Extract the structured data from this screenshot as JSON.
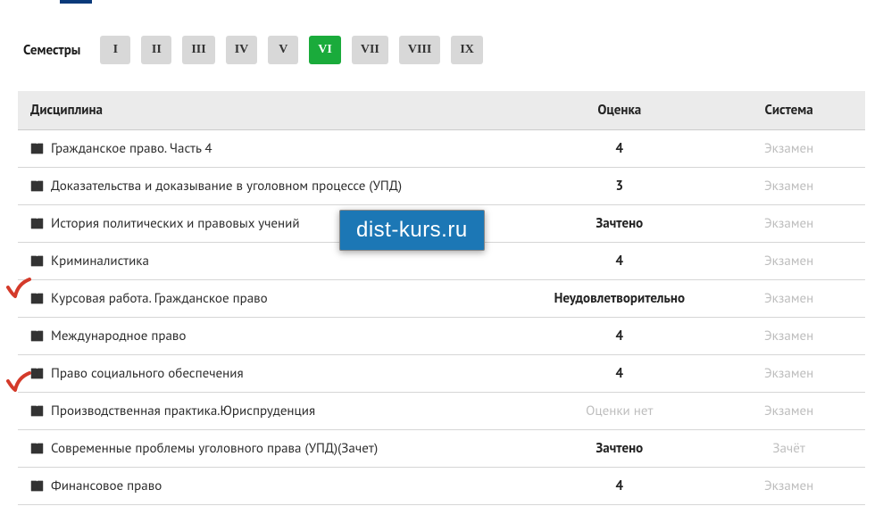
{
  "semesters": {
    "label": "Семестры",
    "items": [
      {
        "label": "I",
        "active": false
      },
      {
        "label": "II",
        "active": false
      },
      {
        "label": "III",
        "active": false
      },
      {
        "label": "IV",
        "active": false
      },
      {
        "label": "V",
        "active": false
      },
      {
        "label": "VI",
        "active": true
      },
      {
        "label": "VII",
        "active": false
      },
      {
        "label": "VIII",
        "active": false
      },
      {
        "label": "IX",
        "active": false
      }
    ]
  },
  "table": {
    "headers": {
      "discipline": "Дисциплина",
      "grade": "Оценка",
      "system": "Система"
    },
    "rows": [
      {
        "discipline": "Гражданское право. Часть 4",
        "grade": "4",
        "grade_style": "bold",
        "system": "Экзамен"
      },
      {
        "discipline": "Доказательства и доказывание в уголовном процессе (УПД)",
        "grade": "3",
        "grade_style": "bold",
        "system": "Экзамен"
      },
      {
        "discipline": "История политических и правовых учений",
        "grade": "Зачтено",
        "grade_style": "bold",
        "system": "Экзамен"
      },
      {
        "discipline": "Криминалистика",
        "grade": "4",
        "grade_style": "bold",
        "system": "Экзамен"
      },
      {
        "discipline": "Курсовая работа. Гражданское право",
        "grade": "Неудовлетворительно",
        "grade_style": "bold",
        "system": "Экзамен"
      },
      {
        "discipline": "Международное право",
        "grade": "4",
        "grade_style": "bold",
        "system": "Экзамен"
      },
      {
        "discipline": "Право социального обеспечения",
        "grade": "4",
        "grade_style": "bold",
        "system": "Экзамен"
      },
      {
        "discipline": "Производственная практика.Юриспруденция",
        "grade": "Оценки нет",
        "grade_style": "muted",
        "system": "Экзамен"
      },
      {
        "discipline": "Современные проблемы уголовного права (УПД)(Зачет)",
        "grade": "Зачтено",
        "grade_style": "bold",
        "system": "Зачёт"
      },
      {
        "discipline": "Финансовое право",
        "grade": "4",
        "grade_style": "bold",
        "system": "Экзамен"
      }
    ]
  },
  "watermark": "dist-kurs.ru"
}
